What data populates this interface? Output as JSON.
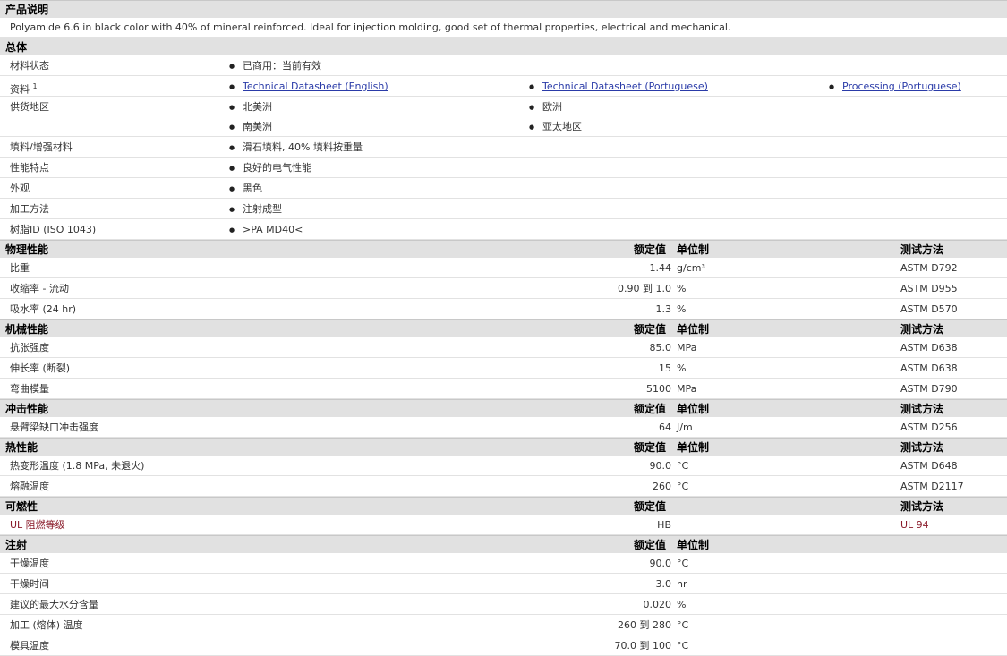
{
  "description": {
    "title": "产品说明",
    "text": "Polyamide 6.6 in black color with 40% of mineral reinforced. Ideal for injection molding, good set of thermal properties, electrical and mechanical."
  },
  "general": {
    "title": "总体",
    "status_label": "材料状态",
    "status_value": "已商用：当前有效",
    "docs_label": "资料",
    "docs_sup": "1",
    "docs": [
      "Technical Datasheet (English)",
      "Technical Datasheet (Portuguese)",
      "Processing (Portuguese)"
    ],
    "availability_label": "供货地区",
    "availability": [
      "北美洲",
      "欧洲",
      "南美洲",
      "亚太地区"
    ],
    "filler_label": "填料/增强材料",
    "filler_value": "滑石填料, 40% 填料按重量",
    "features_label": "性能特点",
    "features_value": "良好的电气性能",
    "appearance_label": "外观",
    "appearance_value": "黑色",
    "processing_label": "加工方法",
    "processing_value": "注射成型",
    "resin_label": "树脂ID (ISO 1043)",
    "resin_value": ">PA MD40<"
  },
  "headers": {
    "nominal": "额定值",
    "unit": "单位制",
    "method": "测试方法"
  },
  "sections": [
    {
      "title": "物理性能",
      "show_unit": true,
      "show_method": true,
      "rows": [
        {
          "label": "比重",
          "value": "1.44",
          "unit": "g/cm³",
          "method": "ASTM D792"
        },
        {
          "label": "收缩率 - 流动",
          "value": "0.90 到  1.0",
          "unit": "%",
          "method": "ASTM D955"
        },
        {
          "label": "吸水率 (24 hr)",
          "value": "1.3",
          "unit": "%",
          "method": "ASTM D570"
        }
      ]
    },
    {
      "title": "机械性能",
      "show_unit": true,
      "show_method": true,
      "rows": [
        {
          "label": "抗张强度",
          "value": "85.0",
          "unit": "MPa",
          "method": "ASTM D638"
        },
        {
          "label": "伸长率 (断裂)",
          "value": "15",
          "unit": "%",
          "method": "ASTM D638"
        },
        {
          "label": "弯曲模量",
          "value": "5100",
          "unit": "MPa",
          "method": "ASTM D790"
        }
      ]
    },
    {
      "title": "冲击性能",
      "show_unit": true,
      "show_method": true,
      "rows": [
        {
          "label": "悬臂梁缺口冲击强度",
          "value": "64",
          "unit": "J/m",
          "method": "ASTM D256"
        }
      ]
    },
    {
      "title": "热性能",
      "show_unit": true,
      "show_method": true,
      "rows": [
        {
          "label": "热变形温度 (1.8 MPa, 未退火)",
          "value": "90.0",
          "unit": "°C",
          "method": "ASTM D648"
        },
        {
          "label": "熔融温度",
          "value": "260",
          "unit": "°C",
          "method": "ASTM D2117"
        }
      ]
    },
    {
      "title": "可燃性",
      "show_unit": false,
      "show_method": true,
      "rows": [
        {
          "label": "UL 阻燃等级",
          "value": "HB",
          "unit": "",
          "method": "UL 94",
          "red": true
        }
      ]
    },
    {
      "title": "注射",
      "show_unit": true,
      "show_method": false,
      "rows": [
        {
          "label": "干燥温度",
          "value": "90.0",
          "unit": "°C",
          "method": ""
        },
        {
          "label": "干燥时间",
          "value": "3.0",
          "unit": "hr",
          "method": ""
        },
        {
          "label": "建议的最大水分含量",
          "value": "0.020",
          "unit": "%",
          "method": ""
        },
        {
          "label": "加工 (熔体) 温度",
          "value": "260 到  280",
          "unit": "°C",
          "method": ""
        },
        {
          "label": "模具温度",
          "value": "70.0 到  100",
          "unit": "°C",
          "method": ""
        }
      ]
    }
  ]
}
